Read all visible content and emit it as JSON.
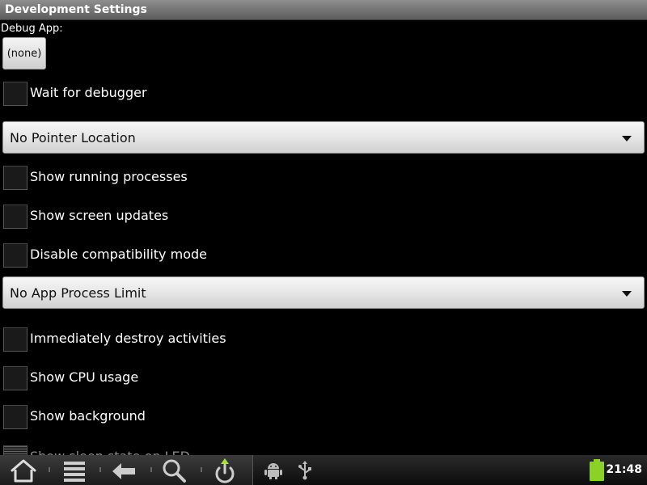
{
  "window": {
    "title": "Development Settings"
  },
  "debug_app": {
    "label": "Debug App:",
    "value": "(none)"
  },
  "settings": {
    "wait_for_debugger": {
      "label": "Wait for debugger",
      "checked": false
    },
    "pointer_location": {
      "selected": "No Pointer Location"
    },
    "show_running_processes": {
      "label": "Show running processes",
      "checked": false
    },
    "show_screen_updates": {
      "label": "Show screen updates",
      "checked": false
    },
    "disable_compat_mode": {
      "label": "Disable compatibility mode",
      "checked": false
    },
    "app_process_limit": {
      "selected": "No App Process Limit"
    },
    "destroy_activities": {
      "label": "Immediately destroy activities",
      "checked": false
    },
    "show_cpu_usage": {
      "label": "Show CPU usage",
      "checked": false
    },
    "show_background": {
      "label": "Show background",
      "checked": false
    },
    "partial_item": {
      "label": "Show sleep state on LED",
      "checked": false
    }
  },
  "system_bar": {
    "nav_icons": [
      "home-icon",
      "menu-icon",
      "back-icon",
      "search-icon",
      "power-icon"
    ],
    "status_icons": [
      "android-debug-icon",
      "usb-icon",
      "battery-icon"
    ],
    "clock": "21:48",
    "battery_color": "#8cd126"
  }
}
